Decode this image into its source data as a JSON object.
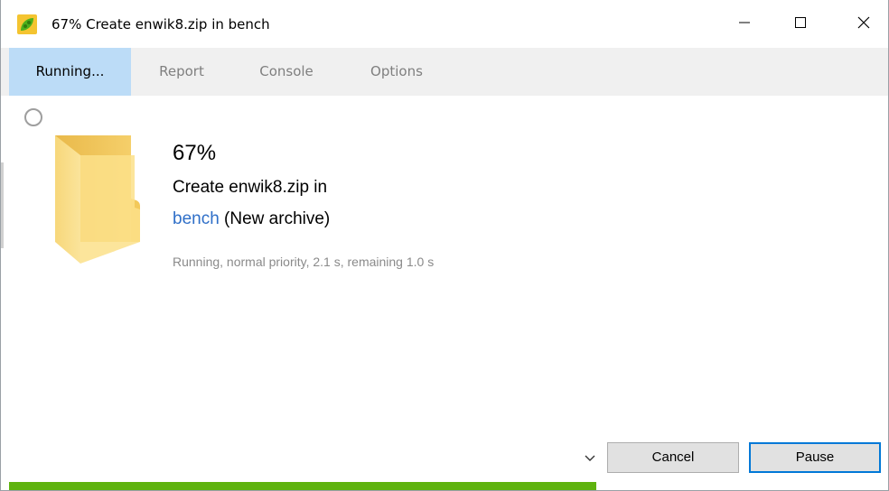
{
  "window": {
    "title": "67% Create enwik8.zip in bench",
    "controls": {
      "minimize": "minimize-icon",
      "maximize": "maximize-icon",
      "close": "close-icon"
    }
  },
  "tabs": [
    {
      "label": "Running...",
      "active": true
    },
    {
      "label": "Report",
      "active": false
    },
    {
      "label": "Console",
      "active": false
    },
    {
      "label": "Options",
      "active": false
    }
  ],
  "task": {
    "percent_text": "67%",
    "operation_text": "Create enwik8.zip in",
    "destination_link": "bench",
    "destination_note": " (New archive)",
    "status_text": "Running, normal priority, 2.1 s, remaining 1.0 s",
    "progress": 0.67
  },
  "buttons": {
    "cancel": "Cancel",
    "pause": "Pause"
  },
  "icons": {
    "app": "peazip-icon",
    "folder": "folder-icon",
    "spinner": "spinner-icon",
    "chevron": "chevron-down-icon"
  },
  "colors": {
    "accent": "#0078d7",
    "tab_active": "#bcdcf7",
    "link": "#2f6fc8",
    "progress": "#5fb30f"
  }
}
